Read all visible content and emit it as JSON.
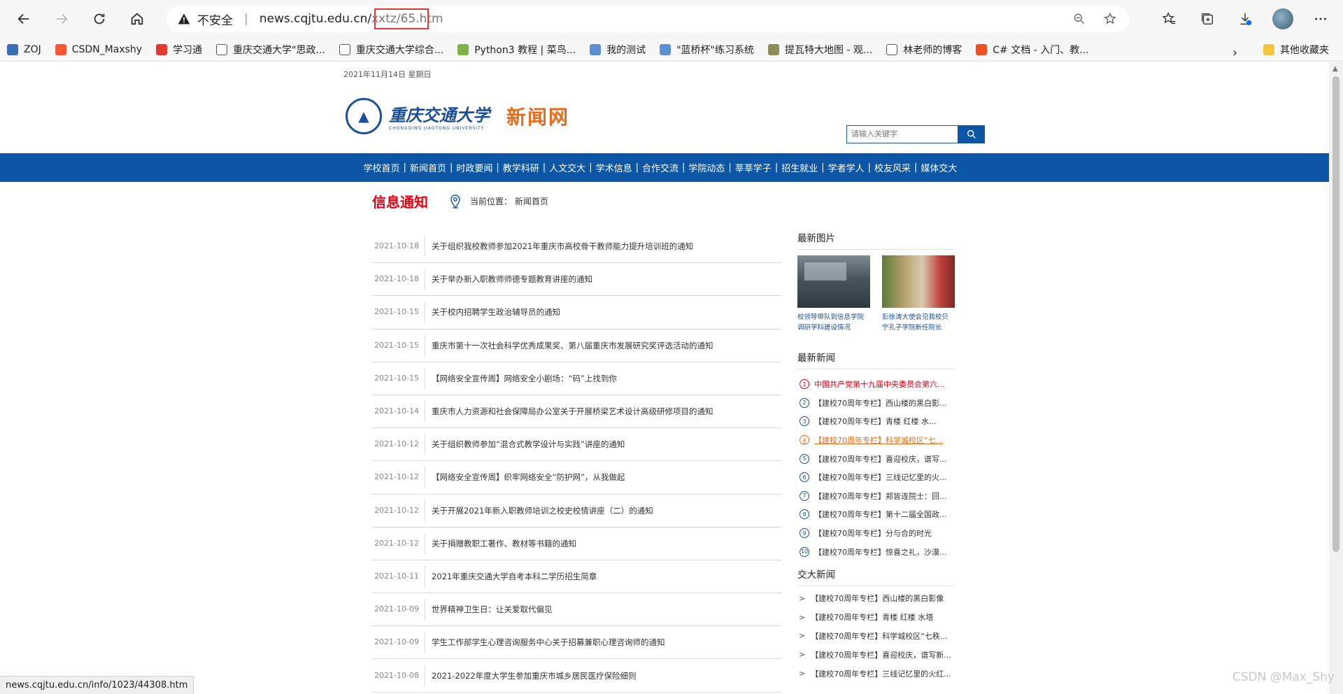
{
  "browser": {
    "security_label": "不安全",
    "url_host": "news.cqjtu.edu.cn/",
    "url_path": "xxtz/65.htm",
    "status_url": "news.cqjtu.edu.cn/info/1023/44308.htm",
    "watermark": "CSDN @Max_Shy"
  },
  "bookmarks": [
    {
      "label": "ZOJ",
      "icon": "zoj-icon",
      "color": "#3a6fb5"
    },
    {
      "label": "CSDN_Maxshy",
      "icon": "csdn-icon",
      "color": "#fc5531"
    },
    {
      "label": "学习通",
      "icon": "xuexitong-icon",
      "color": "#e53935"
    },
    {
      "label": "重庆交通大学\"思政...",
      "icon": "page-icon",
      "color": "#ffffff"
    },
    {
      "label": "重庆交通大学综合...",
      "icon": "page-icon",
      "color": "#ffffff"
    },
    {
      "label": "Python3 教程 | 菜鸟...",
      "icon": "runoob-icon",
      "color": "#7cb342"
    },
    {
      "label": "我的测试",
      "icon": "test-icon",
      "color": "#5c8fd6"
    },
    {
      "label": "\"蓝桥杯\"练习系统",
      "icon": "lanqiao-icon",
      "color": "#5c8fd6"
    },
    {
      "label": "提瓦特大地图 - 观...",
      "icon": "map-icon",
      "color": "#8d8d5a"
    },
    {
      "label": "林老师的博客",
      "icon": "page-icon",
      "color": "#ffffff"
    },
    {
      "label": "C# 文档 - 入门、教...",
      "icon": "microsoft-icon",
      "color": "#f25022"
    }
  ],
  "bookmarks_other": "其他收藏夹",
  "page": {
    "date": "2021年11月14日 星期日",
    "university_name": "重庆交通大学",
    "university_en": "CHONGQING JIAOTONG UNIVERSITY",
    "site_name": "新闻网",
    "search_placeholder": "请输入关键字",
    "nav": [
      "学校首页",
      "新闻首页",
      "时政要闻",
      "教学科研",
      "人文交大",
      "学术信息",
      "合作交流",
      "学院动态",
      "莘莘学子",
      "招生就业",
      "学者学人",
      "校友风采",
      "媒体交大"
    ],
    "section_title": "信息通知",
    "location_label": "当前位置：",
    "location_value": "新闻首页",
    "notices": [
      {
        "date": "2021-10-18",
        "title": "关于组织我校教师参加2021年重庆市高校骨干教师能力提升培训班的通知"
      },
      {
        "date": "2021-10-18",
        "title": "关于举办新入职教师师德专题教育讲座的通知"
      },
      {
        "date": "2021-10-15",
        "title": "关于校内招聘学生政治辅导员的通知"
      },
      {
        "date": "2021-10-15",
        "title": "重庆市第十一次社会科学优秀成果奖、第八届重庆市发展研究奖评选活动的通知"
      },
      {
        "date": "2021-10-15",
        "title": "【网络安全宣传周】网络安全小剧场：“码”上找到你"
      },
      {
        "date": "2021-10-14",
        "title": "重庆市人力资源和社会保障局办公室关于开展桥梁艺术设计高级研修项目的通知"
      },
      {
        "date": "2021-10-12",
        "title": "关于组织教师参加“混合式教学设计与实践”讲座的通知"
      },
      {
        "date": "2021-10-12",
        "title": "【网络安全宣传周】织牢网络安全“防护网”，从我做起"
      },
      {
        "date": "2021-10-12",
        "title": "关于开展2021年新入职教师培训之校史校情讲座（二）的通知"
      },
      {
        "date": "2021-10-12",
        "title": "关于捐赠教职工著作、教材等书籍的通知"
      },
      {
        "date": "2021-10-11",
        "title": "2021年重庆交通大学自考本科二学历招生简章"
      },
      {
        "date": "2021-10-09",
        "title": "世界精神卫生日：让关爱取代偏见"
      },
      {
        "date": "2021-10-09",
        "title": "学生工作部学生心理咨询服务中心关于招募兼职心理咨询师的通知"
      },
      {
        "date": "2021-10-08",
        "title": "2021-2022年度大学生参加重庆市城乡居民医疗保险细则"
      }
    ],
    "latest_pictures_title": "最新图片",
    "pictures": [
      {
        "caption": "校领导带队到信息学院调研学科建设情况"
      },
      {
        "caption": "彭徐涛大使会见我校贝宁孔子学院新任院长"
      }
    ],
    "latest_news_title": "最新新闻",
    "latest_news": [
      {
        "num": "1",
        "title": "中国共产党第十九届中央委员会第六...",
        "style": "red"
      },
      {
        "num": "2",
        "title": "【建校70周年专栏】西山楼的黑白影...",
        "style": ""
      },
      {
        "num": "3",
        "title": "【建校70周年专栏】青楼 红楼 水...",
        "style": ""
      },
      {
        "num": "4",
        "title": "【建校70周年专栏】科学城校区“七...",
        "style": "orange"
      },
      {
        "num": "5",
        "title": "【建校70周年专栏】喜迎校庆，谱写...",
        "style": ""
      },
      {
        "num": "6",
        "title": "【建校70周年专栏】三线记忆里的火...",
        "style": ""
      },
      {
        "num": "7",
        "title": "【建校70周年专栏】郑皆连院士：回...",
        "style": ""
      },
      {
        "num": "8",
        "title": "【建校70周年专栏】第十二届全国政...",
        "style": ""
      },
      {
        "num": "9",
        "title": "【建校70周年专栏】分与合的时光",
        "style": ""
      },
      {
        "num": "10",
        "title": "【建校70周年专栏】惊喜之礼，沙漠...",
        "style": ""
      }
    ],
    "jd_news_title": "交大新闻",
    "jd_news": [
      {
        "title": "【建校70周年专栏】西山楼的黑白影像"
      },
      {
        "title": "【建校70周年专栏】青楼 红楼 水塔"
      },
      {
        "title": "【建校70周年专栏】科学城校区“七秩..."
      },
      {
        "title": "【建校70周年专栏】喜迎校庆，谱写新..."
      },
      {
        "title": "【建校70周年专栏】三线记忆里的火红..."
      }
    ]
  }
}
